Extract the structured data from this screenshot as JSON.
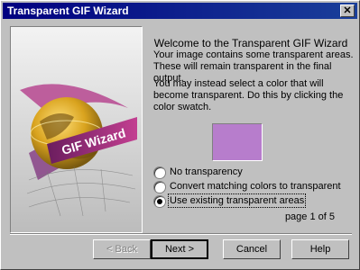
{
  "window": {
    "title": "Transparent GIF Wizard",
    "close_glyph": "✕"
  },
  "art": {
    "banner_text": "GIF Wizard"
  },
  "content": {
    "heading": "Welcome to the Transparent GIF Wizard",
    "para1": "Your image contains some transparent areas. These will remain transparent in the final output.",
    "para2": "You may instead select a color that will become transparent.  Do this by clicking the color swatch.",
    "swatch_color": "#b77dcc"
  },
  "options": [
    {
      "label": "No transparency",
      "checked": false
    },
    {
      "label": "Convert matching colors to transparent",
      "checked": false
    },
    {
      "label": "Use existing transparent areas",
      "checked": true
    }
  ],
  "page_indicator": "page 1 of 5",
  "buttons": {
    "back": "< Back",
    "next": "Next >",
    "cancel": "Cancel",
    "help": "Help"
  }
}
